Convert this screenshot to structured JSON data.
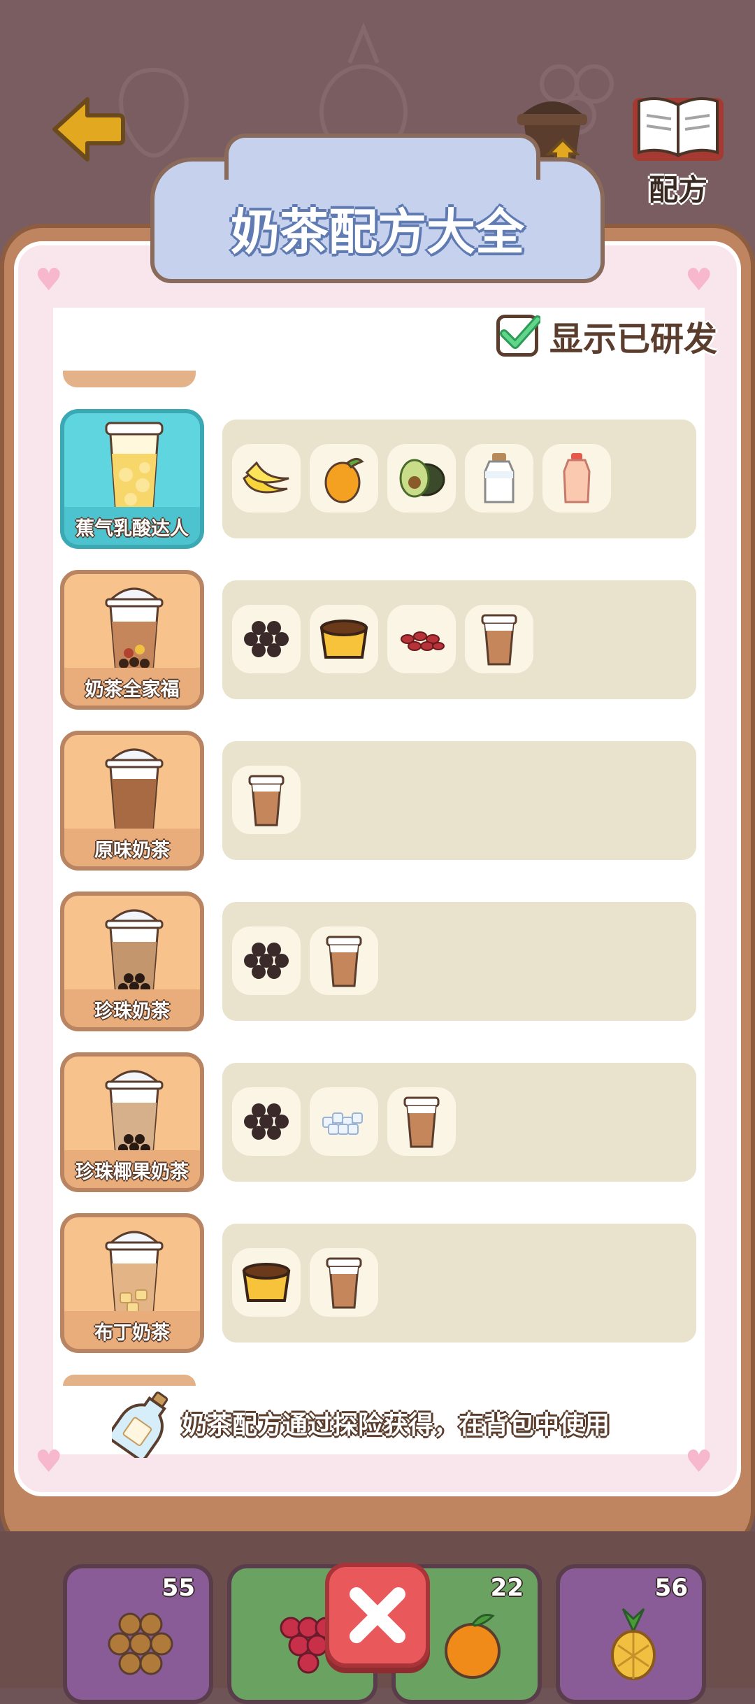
{
  "header": {
    "upgrade_label": "升级",
    "recipe_label": "配方"
  },
  "title": "奶茶配方大全",
  "toggle": {
    "label": "显示已研发",
    "checked": true
  },
  "recipes": [
    {
      "name": "蕉气乳酸达人",
      "highlight": true,
      "ingredients": [
        "banana-icon",
        "mango-icon",
        "avocado-icon",
        "milk-bottle-icon",
        "yogurt-drink-icon"
      ]
    },
    {
      "name": "奶茶全家福",
      "highlight": false,
      "ingredients": [
        "tapioca-pearls-icon",
        "pudding-icon",
        "red-beans-icon",
        "milk-tea-cup-icon"
      ]
    },
    {
      "name": "原味奶茶",
      "highlight": false,
      "ingredients": [
        "milk-tea-cup-icon"
      ]
    },
    {
      "name": "珍珠奶茶",
      "highlight": false,
      "ingredients": [
        "tapioca-pearls-icon",
        "milk-tea-cup-icon"
      ]
    },
    {
      "name": "珍珠椰果奶茶",
      "highlight": false,
      "ingredients": [
        "tapioca-pearls-icon",
        "coconut-jelly-icon",
        "milk-tea-cup-icon"
      ]
    },
    {
      "name": "布丁奶茶",
      "highlight": false,
      "ingredients": [
        "pudding-icon",
        "milk-tea-cup-icon"
      ]
    }
  ],
  "footer_text": "奶茶配方通过探险获得，在背包中使用",
  "inventory": [
    {
      "icon": "tapioca-pearls-icon",
      "count": "55",
      "color": "#8a5c97"
    },
    {
      "icon": "grapes-icon",
      "count": "",
      "color": "#6aa261"
    },
    {
      "icon": "orange-icon",
      "count": "22",
      "color": "#6aa261"
    },
    {
      "icon": "pineapple-icon",
      "count": "56",
      "color": "#8a5c97"
    }
  ],
  "colors": {
    "background": "#6f5457",
    "board": "#bf8560",
    "title_banner": "#c6d1ee",
    "highlight_card": "#5fd6df",
    "normal_card": "#f8c28d",
    "close_button": "#e9585b"
  }
}
